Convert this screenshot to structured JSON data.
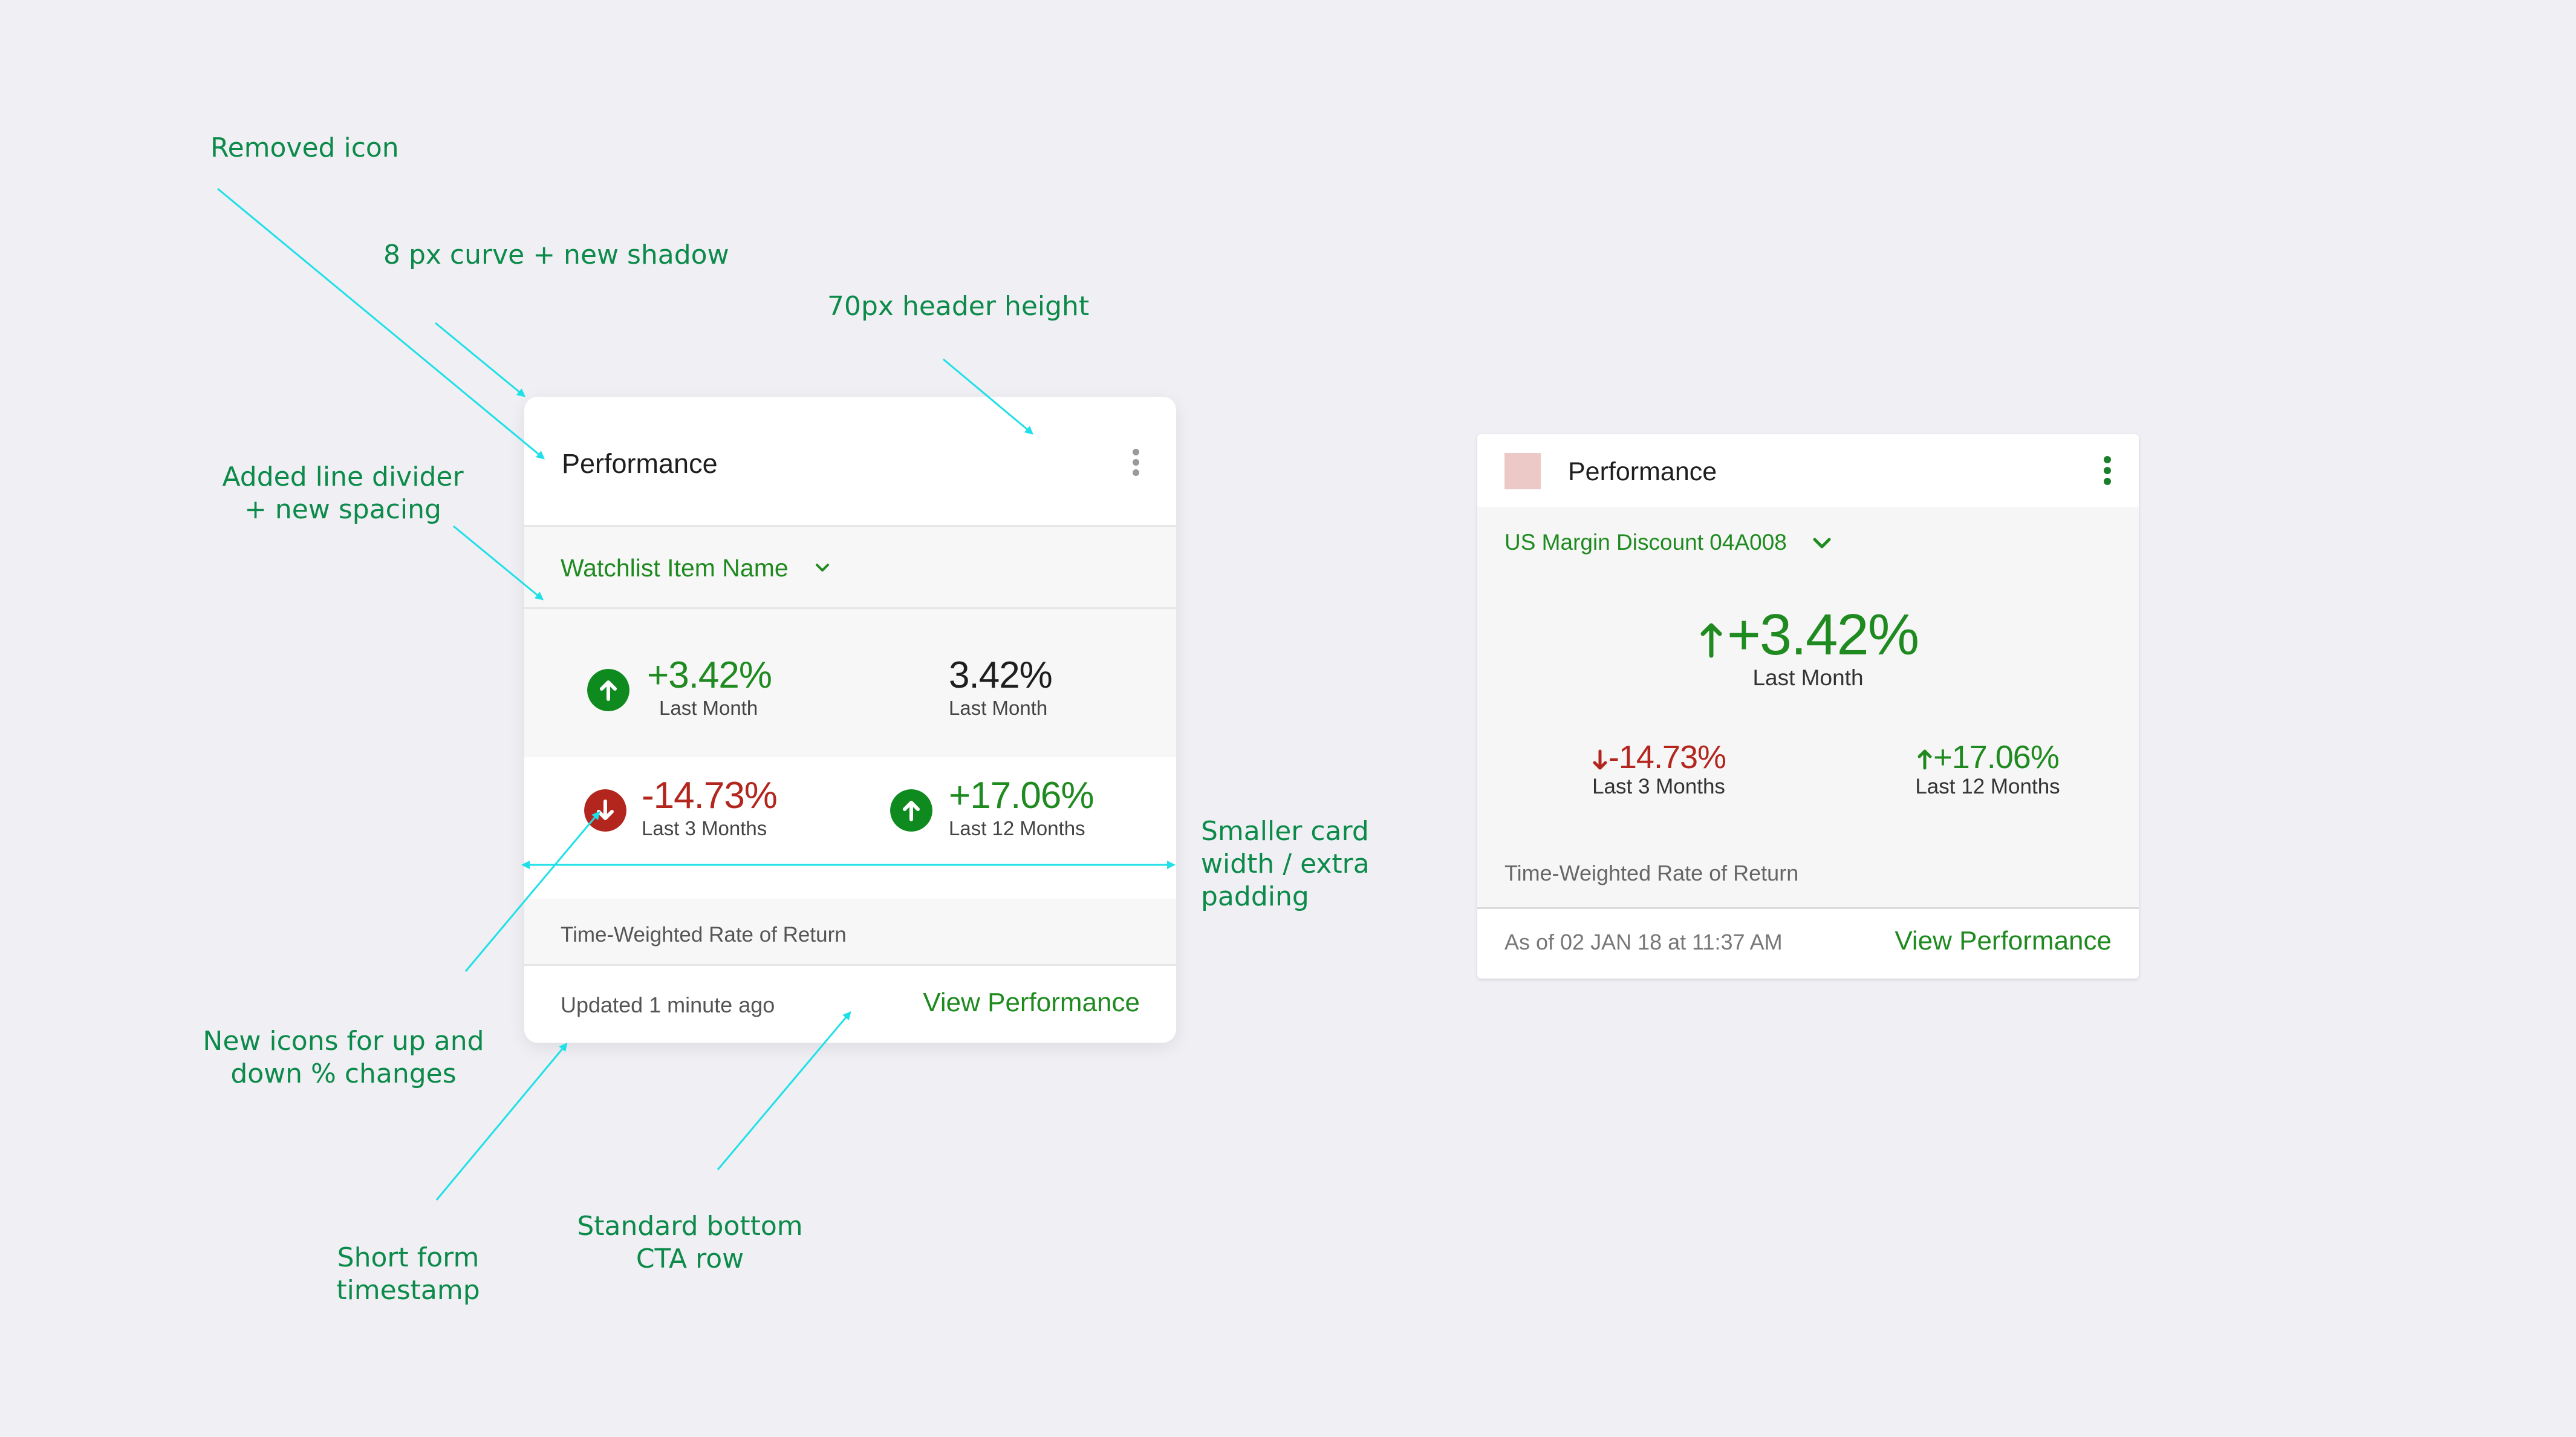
{
  "annotations": {
    "removed_icon": "Removed icon",
    "curve_shadow": "8 px curve + new shadow",
    "header_height": "70px header height",
    "line_divider_1": "Added line divider",
    "line_divider_2": "+ new spacing",
    "smaller_card_1": "Smaller card",
    "smaller_card_2": "width / extra",
    "smaller_card_3": "padding",
    "new_icons_1": "New icons for up and",
    "new_icons_2": "down % changes",
    "short_timestamp_1": "Short form",
    "short_timestamp_2": "timestamp",
    "standard_cta_1": "Standard bottom",
    "standard_cta_2": "CTA row"
  },
  "card_new": {
    "title": "Performance",
    "watchlist": "Watchlist Item Name",
    "stats": [
      {
        "value": "+3.42%",
        "label": "Last Month",
        "trend": "up"
      },
      {
        "value": "3.42%",
        "label": "Last Month",
        "trend": "none"
      },
      {
        "value": "-14.73%",
        "label": "Last 3 Months",
        "trend": "down"
      },
      {
        "value": "+17.06%",
        "label": "Last 12 Months",
        "trend": "up"
      }
    ],
    "caption": "Time-Weighted Rate of Return",
    "updated": "Updated 1 minute ago",
    "cta": "View Performance"
  },
  "card_old": {
    "title": "Performance",
    "watchlist": "US Margin Discount 04A008",
    "main_value": "+3.42%",
    "main_label": "Last Month",
    "stats": [
      {
        "value": "-14.73%",
        "label": "Last 3 Months",
        "trend": "down"
      },
      {
        "value": "+17.06%",
        "label": "Last 12 Months",
        "trend": "up"
      }
    ],
    "caption": "Time-Weighted Rate of Return",
    "asof": "As of 02 JAN 18 at 11:37 AM",
    "cta": "View Performance"
  },
  "colors": {
    "positive": "#1f8a1f",
    "negative": "#b3261e",
    "annotation": "#0c8a4a",
    "arrow": "#1ee0e8"
  },
  "icons": [
    "kebab-menu-icon",
    "chevron-down-icon",
    "arrow-up-circle-icon",
    "arrow-down-circle-icon",
    "arrow-up-icon",
    "arrow-down-icon"
  ]
}
